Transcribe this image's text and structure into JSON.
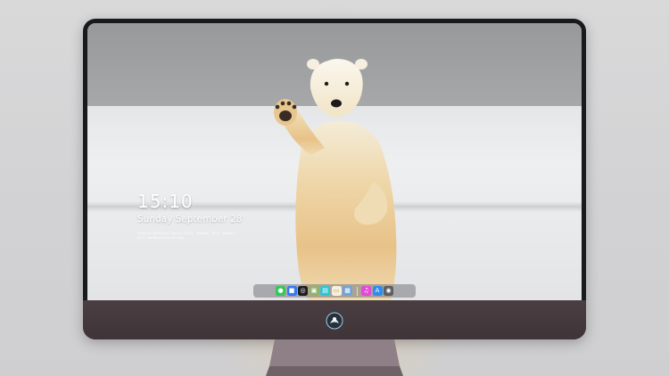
{
  "lockscreen": {
    "time": "15:10",
    "date": "Sunday September 28",
    "notification": "Unknown (Windows, Ubuntu 24.04 · Settings · Wi-Fi · Battery 87% · Notifications (no new))"
  },
  "dock": {
    "items": [
      {
        "name": "messages-icon",
        "glyph": "●",
        "color": "#34c759"
      },
      {
        "name": "files-icon",
        "glyph": "■",
        "color": "#3478f6"
      },
      {
        "name": "safari-icon",
        "glyph": "◎",
        "color": "#1f1f1f"
      },
      {
        "name": "preview-icon",
        "glyph": "▣",
        "color": "#8fb36a"
      },
      {
        "name": "claquette-icon",
        "glyph": "▤",
        "color": "#2ec4d6"
      },
      {
        "name": "notes-icon",
        "glyph": "▭",
        "color": "#f5f0e0"
      },
      {
        "name": "photos-icon",
        "glyph": "▦",
        "color": "#6fa3d8"
      },
      {
        "name": "music-icon",
        "glyph": "♫",
        "color": "#e14ad8"
      },
      {
        "name": "appstore-icon",
        "glyph": "A",
        "color": "#2d8cf0"
      },
      {
        "name": "camera-icon",
        "glyph": "◉",
        "color": "#5d5d62"
      }
    ]
  }
}
